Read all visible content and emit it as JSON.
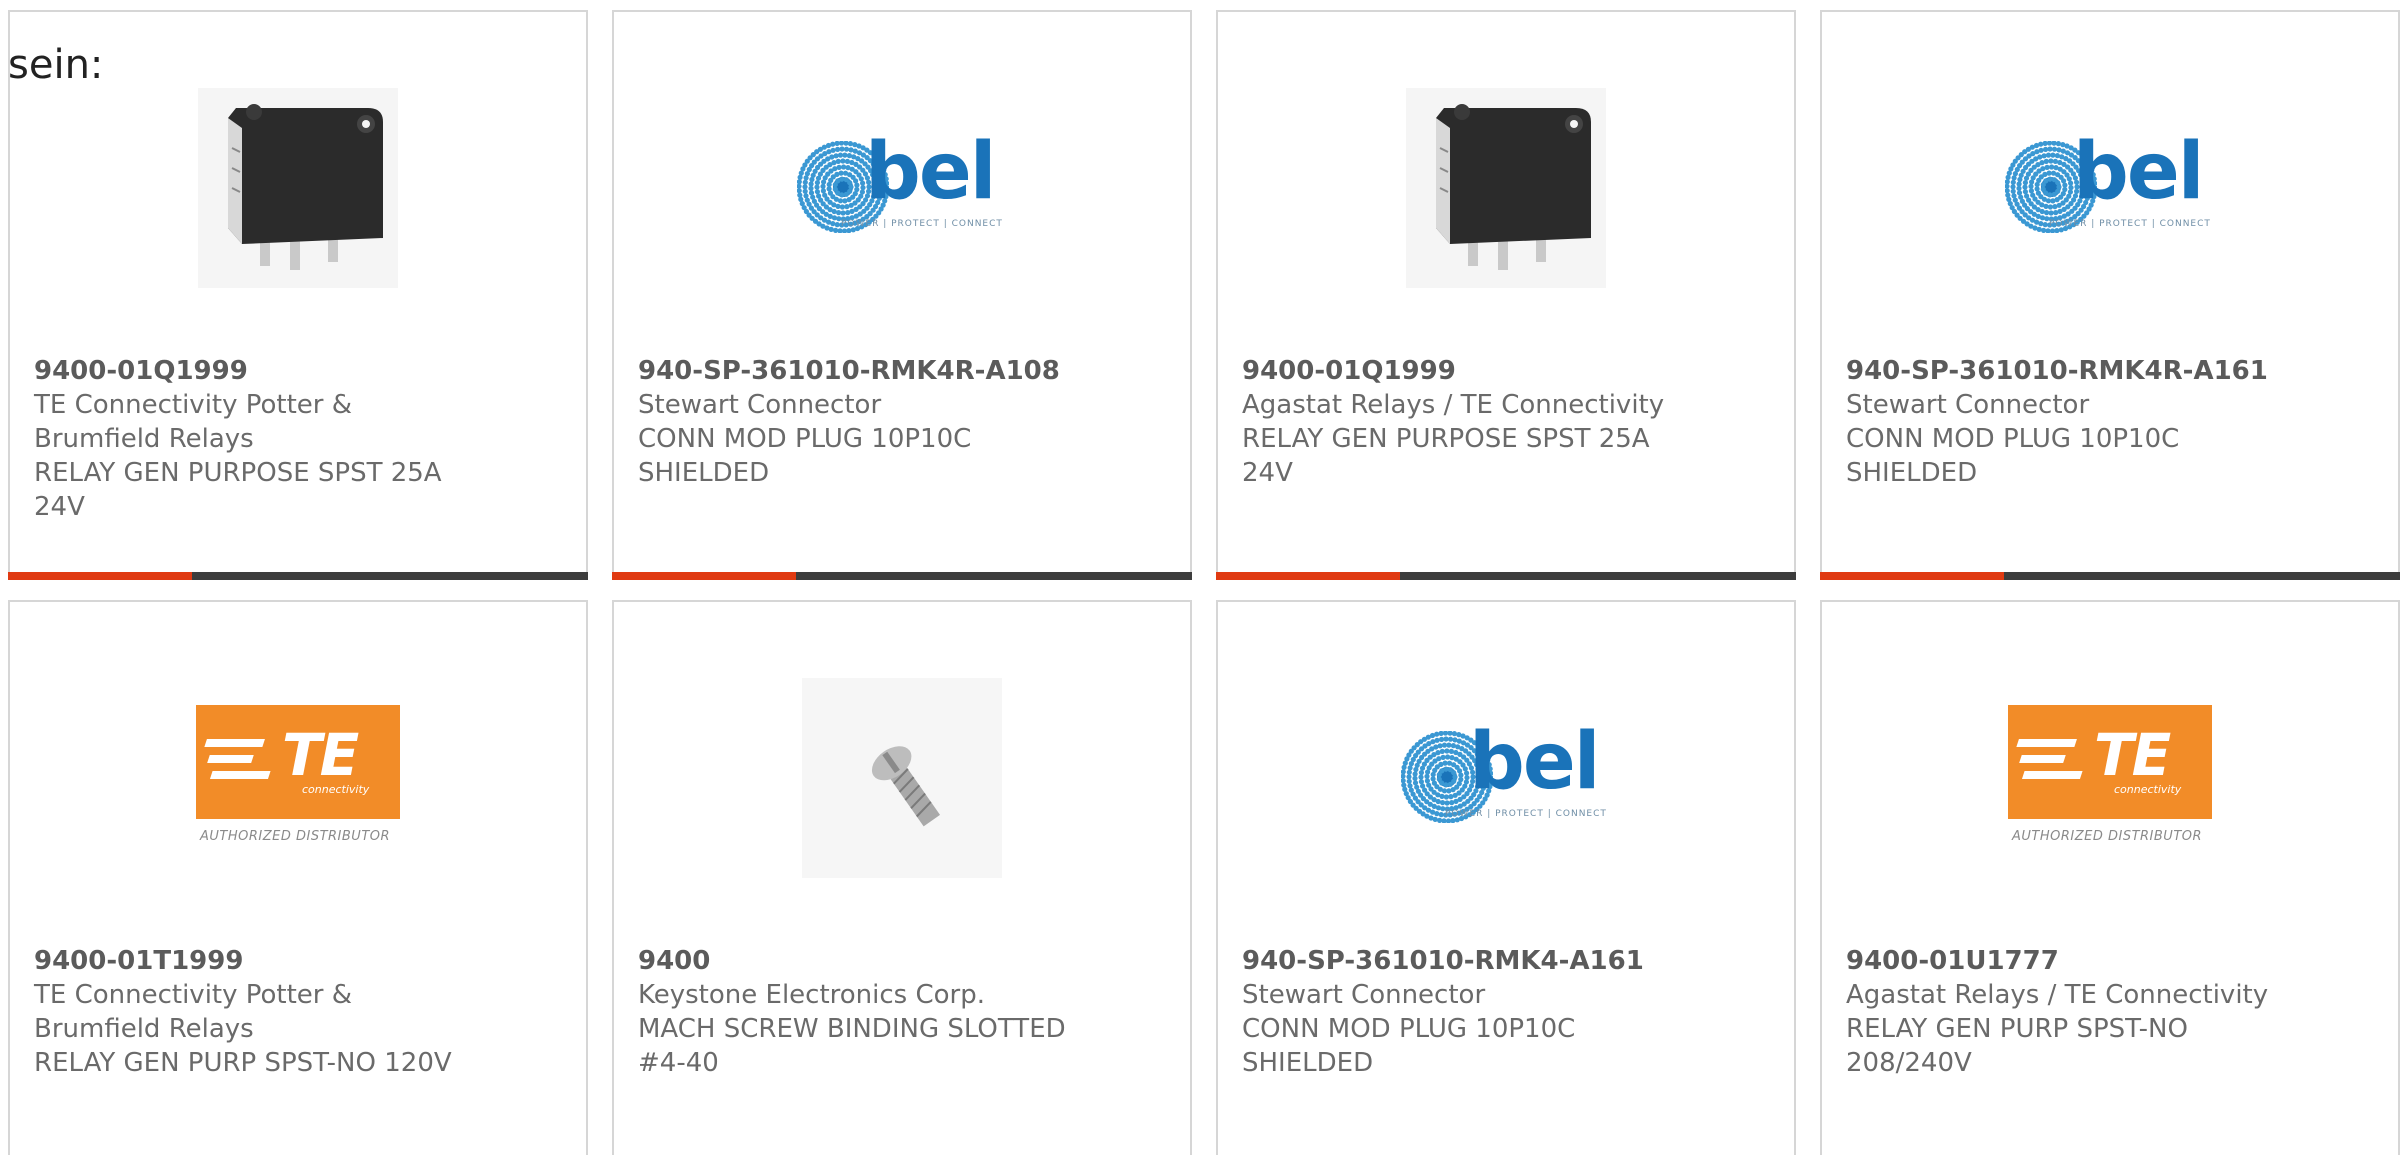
{
  "lead_text": "sein:",
  "colors": {
    "card_border": "#d6d6d6",
    "bar_dark": "#3d3d3d",
    "bar_accent": "#e03a12",
    "text": "#6a6a6a",
    "bel_blue": "#1a73b9",
    "te_orange": "#f28c28"
  },
  "bel_logo": {
    "word": "bel",
    "tagline": "POWER | PROTECT | CONNECT"
  },
  "te_logo": {
    "word": "TE",
    "sub": "connectivity",
    "authorized": "AUTHORIZED DISTRIBUTOR"
  },
  "products": [
    {
      "image": "relay-photo",
      "part_number": "9400-01Q1999",
      "manufacturer_lines": [
        "TE Connectivity Potter &",
        "Brumfield Relays"
      ],
      "description_lines": [
        "RELAY GEN PURPOSE SPST 25A",
        "24V"
      ]
    },
    {
      "image": "bel-logo",
      "part_number": "940-SP-361010-RMK4R-A108",
      "manufacturer_lines": [
        "Stewart Connector"
      ],
      "description_lines": [
        "CONN MOD PLUG 10P10C",
        "SHIELDED"
      ]
    },
    {
      "image": "relay-photo",
      "part_number": "9400-01Q1999",
      "manufacturer_lines": [
        "Agastat Relays / TE Connectivity"
      ],
      "description_lines": [
        "RELAY GEN PURPOSE SPST 25A",
        "24V"
      ]
    },
    {
      "image": "bel-logo",
      "part_number": "940-SP-361010-RMK4R-A161",
      "manufacturer_lines": [
        "Stewart Connector"
      ],
      "description_lines": [
        "CONN MOD PLUG 10P10C",
        "SHIELDED"
      ]
    },
    {
      "image": "te-logo",
      "part_number": "9400-01T1999",
      "manufacturer_lines": [
        "TE Connectivity Potter &",
        "Brumfield Relays"
      ],
      "description_lines": [
        "RELAY GEN PURP SPST-NO 120V"
      ]
    },
    {
      "image": "screw-photo",
      "part_number": "9400",
      "manufacturer_lines": [
        "Keystone Electronics Corp."
      ],
      "description_lines": [
        "MACH SCREW BINDING SLOTTED",
        "#4-40"
      ]
    },
    {
      "image": "bel-logo",
      "part_number": "940-SP-361010-RMK4-A161",
      "manufacturer_lines": [
        "Stewart Connector"
      ],
      "description_lines": [
        "CONN MOD PLUG 10P10C",
        "SHIELDED"
      ]
    },
    {
      "image": "te-logo",
      "part_number": "9400-01U1777",
      "manufacturer_lines": [
        "Agastat Relays / TE Connectivity"
      ],
      "description_lines": [
        "RELAY GEN PURP SPST-NO",
        "208/240V"
      ]
    }
  ]
}
